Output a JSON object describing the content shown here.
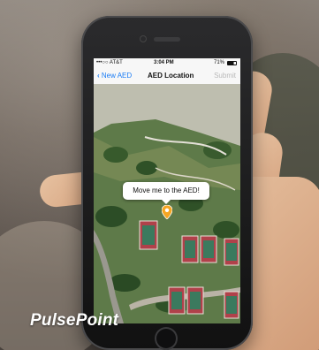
{
  "status_bar": {
    "carrier": "•••○○ AT&T",
    "time": "3:04 PM",
    "battery": "71%"
  },
  "nav": {
    "back_label": "New AED",
    "title": "AED Location",
    "submit_label": "Submit"
  },
  "map": {
    "callout_text": "Move me to the AED!",
    "pin_color": "#f5a623"
  },
  "brand": {
    "logo_text": "PulsePoint"
  },
  "colors": {
    "ios_blue": "#1a7cf5",
    "disabled_gray": "#b9b9b9",
    "court_red": "#b0414a"
  }
}
